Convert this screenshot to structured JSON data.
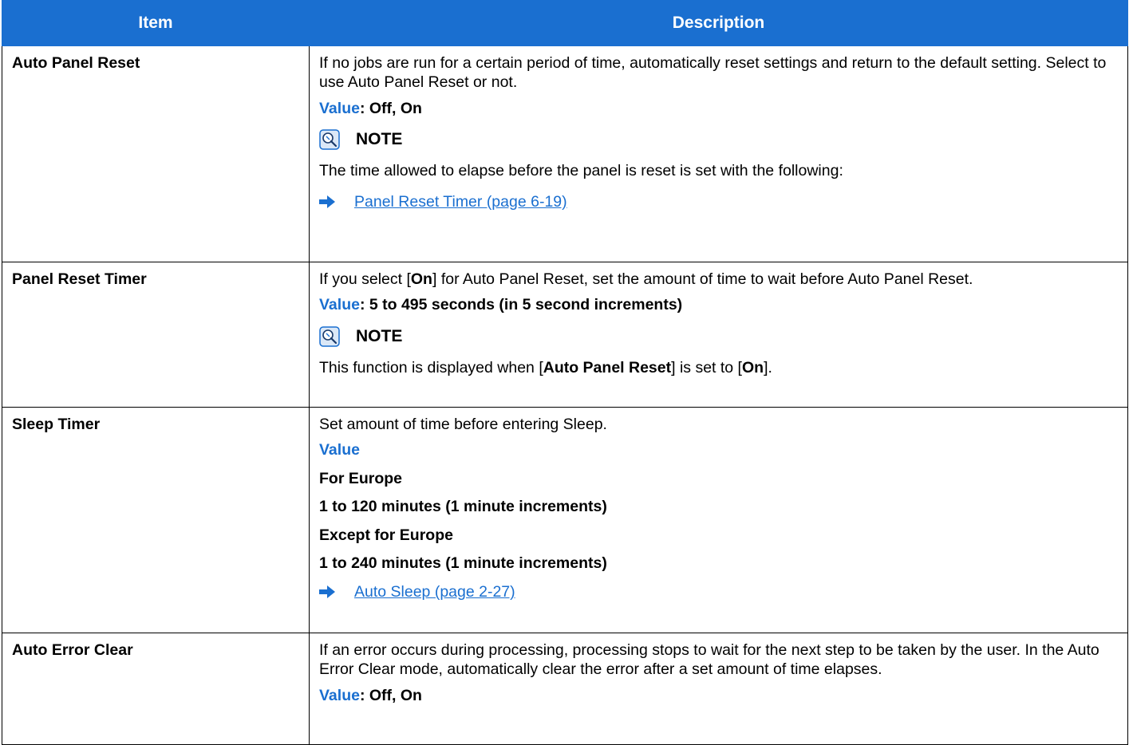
{
  "header": {
    "item": "Item",
    "description": "Description"
  },
  "rows": [
    {
      "item": "Auto Panel Reset",
      "desc": "If no jobs are run for a certain period of time, automatically reset settings and return to the default setting. Select to use Auto Panel Reset or not.",
      "value_label": "Value",
      "value_text": ": Off, On",
      "note_title": "NOTE",
      "note_text": "The time allowed to elapse before the panel is reset is set with the following:",
      "link": "Panel Reset Timer (page 6-19)"
    },
    {
      "item": "Panel Reset Timer",
      "desc_a": "If you select [",
      "desc_b": "On",
      "desc_c": "] for Auto Panel Reset, set the amount of time to wait before Auto Panel Reset.",
      "value_label": "Value",
      "value_text": ": 5 to 495 seconds (in 5 second increments)",
      "note_title": "NOTE",
      "note_a": "This function is displayed when [",
      "note_b": "Auto Panel Reset",
      "note_c": "] is set to [",
      "note_d": "On",
      "note_e": "]."
    },
    {
      "item": "Sleep Timer",
      "desc": "Set amount of time before entering Sleep.",
      "value_label": "Value",
      "lines": [
        "For Europe",
        "1 to 120 minutes (1 minute increments)",
        "Except for Europe",
        "1 to 240 minutes (1 minute increments)"
      ],
      "link": "Auto Sleep (page 2-27)"
    },
    {
      "item": "Auto Error Clear",
      "desc": "If an error occurs during processing, processing stops to wait for the next step to be taken by the user. In the Auto Error Clear mode, automatically clear the error after a set amount of time elapses.",
      "value_label": "Value",
      "value_text": ": Off, On"
    }
  ],
  "colors": {
    "accent": "#1a6fd0"
  },
  "icons": {
    "note": "lightbulb-note-icon",
    "arrow": "right-arrow-icon"
  }
}
